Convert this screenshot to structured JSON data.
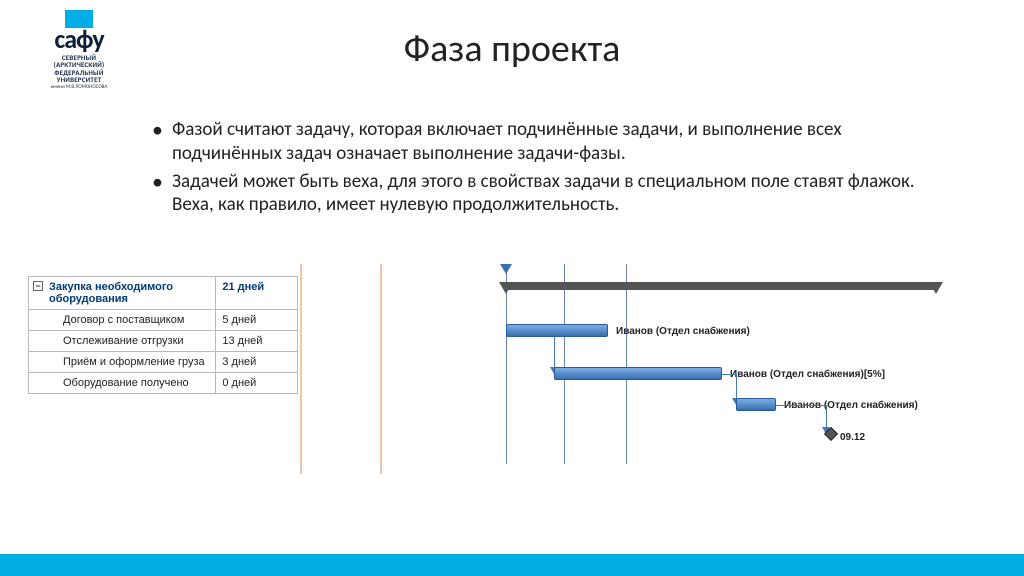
{
  "logo": {
    "name": "сафу",
    "sub": "СЕВЕРНЫЙ\n(АРКТИЧЕСКИЙ)\nФЕДЕРАЛЬНЫЙ\nУНИВЕРСИТЕТ",
    "sub2": "имени М.В.ЛОМОНОСОВА"
  },
  "title": "Фаза проекта",
  "bullets": [
    "Фазой считают задачу, которая включает подчинённые задачи, и выполнение всех подчинённых задач означает выполнение задачи-фазы.",
    "Задачей может быть веха, для этого в свойствах задачи в специальном поле ставят флажок. Веха, как правило, имеет нулевую продолжительность."
  ],
  "table": {
    "summary": {
      "name": "Закупка необходимого оборудования",
      "duration": "21 дней"
    },
    "rows": [
      {
        "name": "Договор с поставщиком",
        "duration": "5 дней"
      },
      {
        "name": "Отслеживание отгрузки",
        "duration": "13 дней"
      },
      {
        "name": "Приём и оформление груза",
        "duration": "3 дней"
      },
      {
        "name": "Оборудование получено",
        "duration": "0 дней"
      }
    ]
  },
  "gantt": {
    "labels": {
      "task1": "Иванов (Отдел снабжения)",
      "task2": "Иванов (Отдел снабжения)[5%]",
      "task3": "Иванов (Отдел снабжения)",
      "milestone": "09.12"
    }
  },
  "colors": {
    "accent": "#00aee5",
    "bar": "#3a6fb0"
  }
}
